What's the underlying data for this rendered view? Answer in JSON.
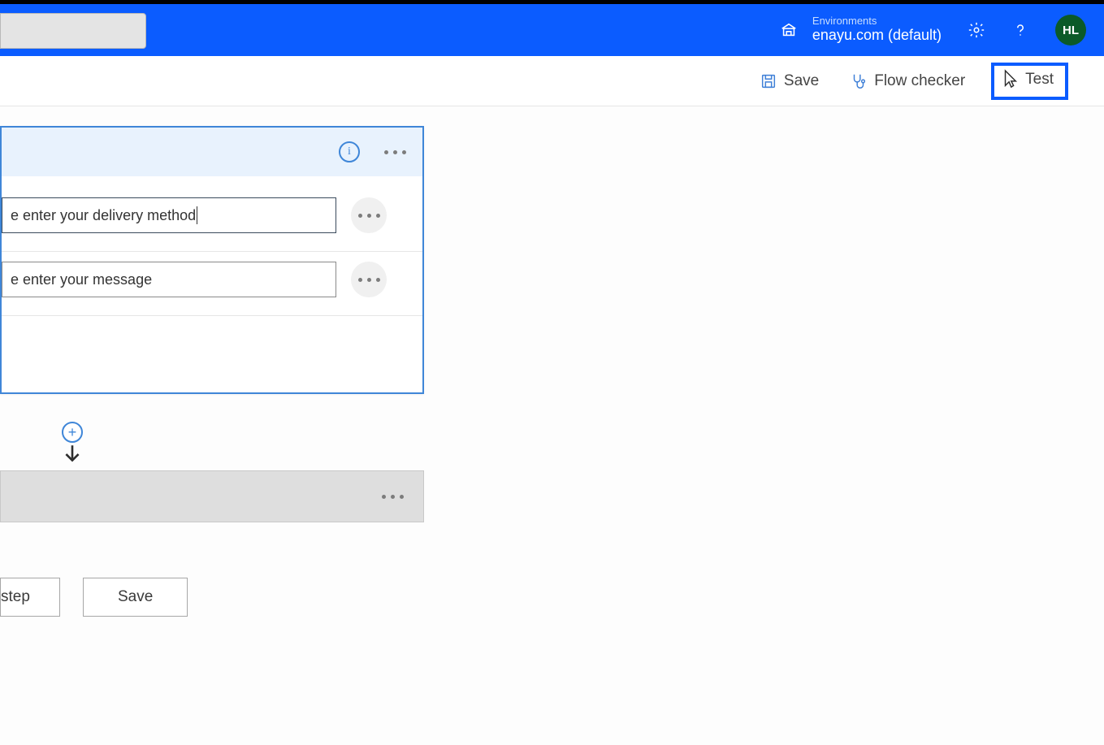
{
  "header": {
    "environments_label": "Environments",
    "environment_value": "enayu.com (default)",
    "avatar_initials": "HL"
  },
  "cmdbar": {
    "save_label": "Save",
    "flow_checker_label": "Flow checker",
    "test_label": "Test"
  },
  "trigger_card": {
    "inputs": [
      {
        "value": "e enter your delivery method"
      },
      {
        "value": "e enter your message"
      }
    ]
  },
  "bottom": {
    "step_label": "step",
    "save_label": "Save"
  }
}
